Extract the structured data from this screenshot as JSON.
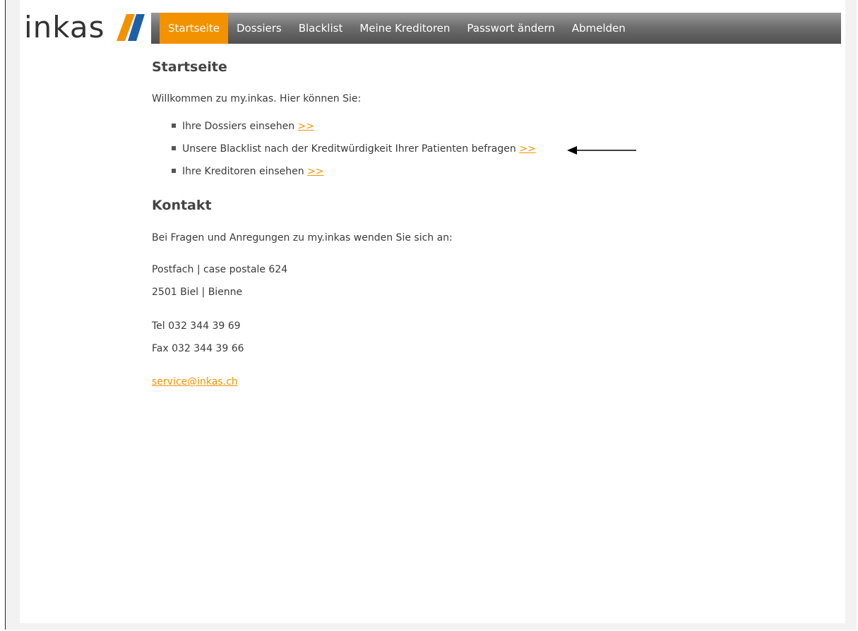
{
  "logo": {
    "text": "inkas"
  },
  "nav": {
    "items": [
      {
        "label": "Startseite",
        "active": true
      },
      {
        "label": "Dossiers"
      },
      {
        "label": "Blacklist"
      },
      {
        "label": "Meine Kreditoren"
      },
      {
        "label": "Passwort ändern"
      },
      {
        "label": "Abmelden"
      }
    ]
  },
  "main": {
    "title": "Startseite",
    "intro": "Willkommen zu my.inkas. Hier können Sie:",
    "list": [
      {
        "text": "Ihre Dossiers einsehen",
        "link": ">>"
      },
      {
        "text": "Unsere Blacklist nach der Kreditwürdigkeit Ihrer Patienten befragen",
        "link": ">>"
      },
      {
        "text": "Ihre Kreditoren einsehen",
        "link": ">>"
      }
    ]
  },
  "contact": {
    "title": "Kontakt",
    "intro": "Bei Fragen und Anregungen zu my.inkas wenden Sie sich an:",
    "address_line1": "Postfach | case postale 624",
    "address_line2": "2501 Biel | Bienne",
    "tel": "Tel 032 344 39 69",
    "fax": "Fax 032 344 39 66",
    "email": "service@inkas.ch"
  },
  "colors": {
    "accent": "#f39200",
    "nav_dark": "#505050",
    "logo_blue": "#1f5fa8"
  }
}
